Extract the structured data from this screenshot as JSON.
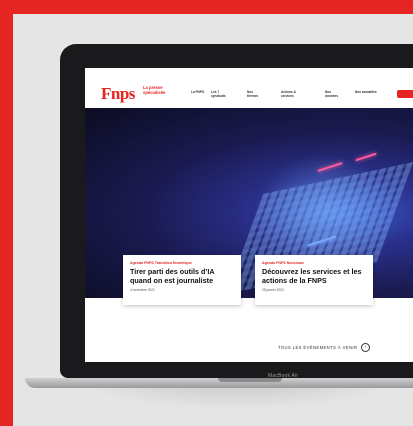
{
  "brand": {
    "logo": "Fnps",
    "tagline": "La presse spécialisée",
    "accent_color": "#e52521"
  },
  "nav": {
    "items": [
      {
        "label": "La FNPS"
      },
      {
        "label": "Les 7 syndicats"
      },
      {
        "label": "Nos thèmes"
      },
      {
        "label": "Actions & services"
      },
      {
        "label": "Nos données"
      },
      {
        "label": "Nos actualités"
      }
    ]
  },
  "cards": [
    {
      "tags": "Agenda  FNPS  Transition Numérique",
      "title": "Tirer parti des outils d’IA quand on est journaliste",
      "date": "4 novembre 2022"
    },
    {
      "tags": "Agenda  FNPS  Nouveaux",
      "title": "Découvrez les services et les actions de la FNPS",
      "date": "25 janvier 2023"
    }
  ],
  "events_link": {
    "label": "TOUS LES ÉVÉNEMENTS À VENIR",
    "icon": "arrow-right-icon"
  },
  "device": {
    "model": "MacBook Air"
  }
}
